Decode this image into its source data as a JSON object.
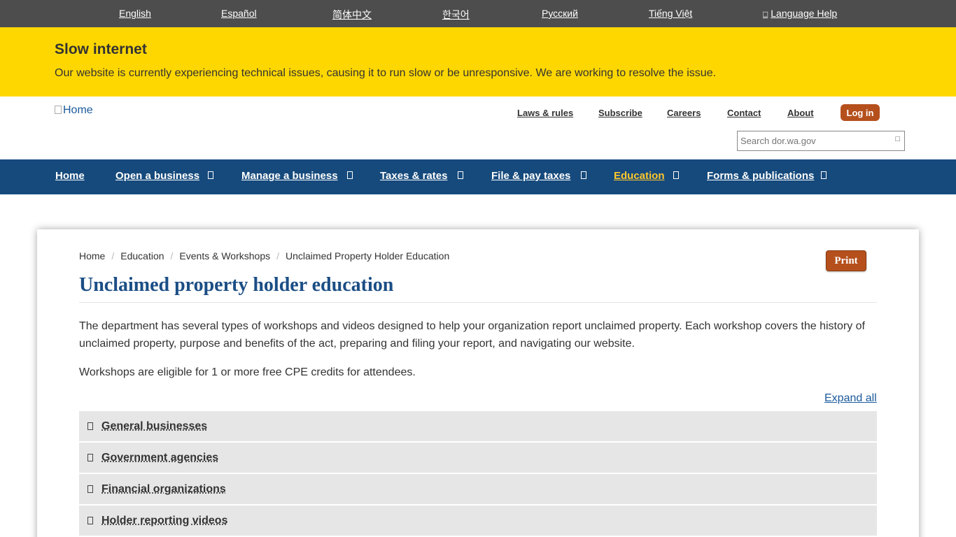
{
  "language_bar": {
    "items": [
      "English",
      "Español",
      "简体中文",
      "한국어",
      "Русский",
      "Tiếng Việt",
      "Language Help"
    ]
  },
  "alert": {
    "title": "Slow internet",
    "message": "Our website is currently experiencing technical issues, causing it to run slow or be unresponsive. We are working to resolve the issue."
  },
  "header": {
    "logo_alt": "Home",
    "utility_links": [
      "Laws & rules",
      "Subscribe",
      "Careers",
      "Contact",
      "About"
    ],
    "login_label": "Log in",
    "search_placeholder": "Search dor.wa.gov"
  },
  "main_nav": {
    "items": [
      "Home",
      "Open a business",
      "Manage a business",
      "Taxes & rates",
      "File & pay taxes",
      "Education",
      "Forms & publications"
    ],
    "active": "Education"
  },
  "breadcrumb": [
    "Home",
    "Education",
    "Events & Workshops",
    "Unclaimed Property Holder Education"
  ],
  "print_label": "Print",
  "page_title": "Unclaimed property holder education",
  "intro_paragraphs": [
    "The department has several types of workshops and videos designed to help your organization report unclaimed property. Each workshop covers the history of unclaimed property, purpose and benefits of the act, preparing and filing your report, and navigating our website.",
    "Workshops are eligible for 1 or more free CPE credits for attendees."
  ],
  "expand_all_label": "Expand all",
  "accordion": [
    "General businesses",
    "Government agencies",
    "Financial organizations",
    "Holder reporting videos"
  ],
  "colors": {
    "nav_blue": "#164a7c",
    "alert_yellow": "#ffd700",
    "accent_orange": "#b5501d",
    "title_blue": "#1b4e85",
    "active_nav": "#ffc82d"
  }
}
